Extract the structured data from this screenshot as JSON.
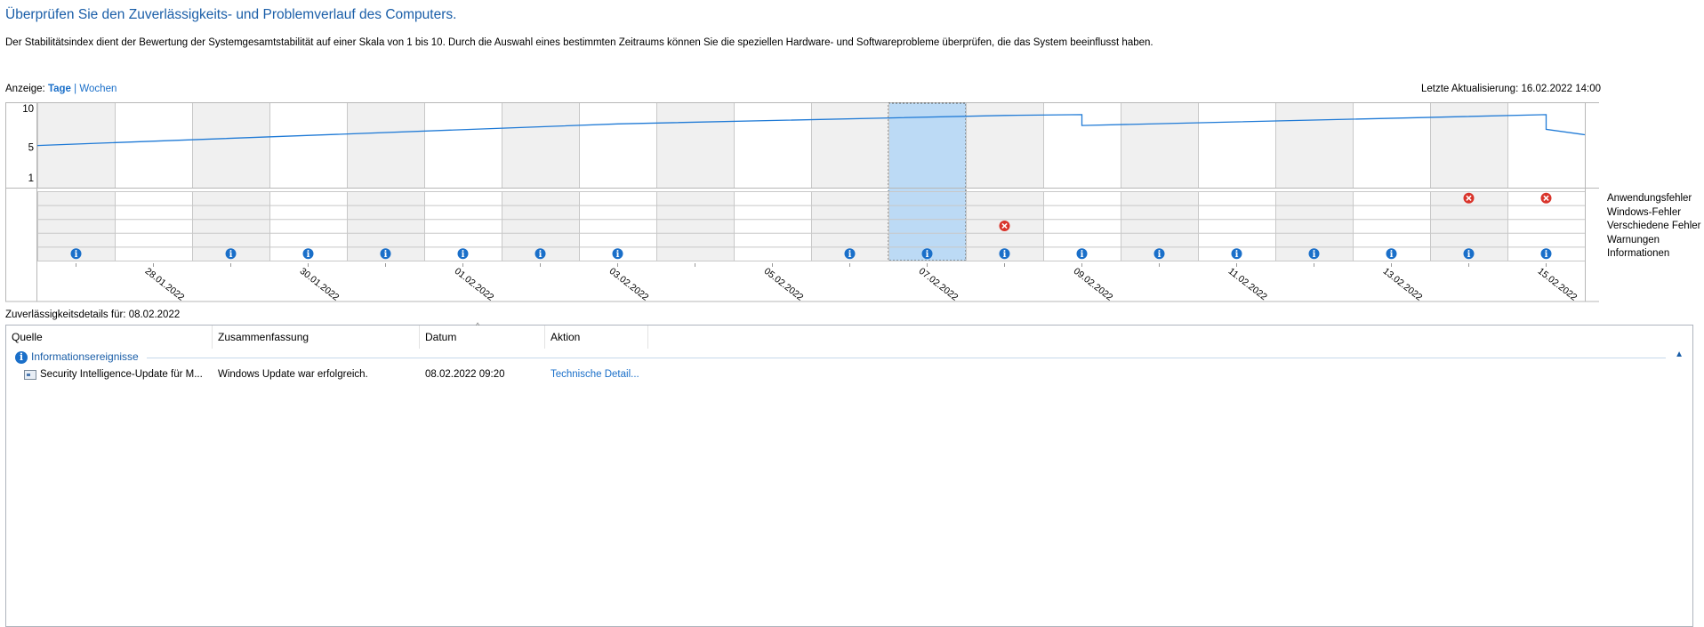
{
  "header": {
    "title": "Überprüfen Sie den Zuverlässigkeits- und Problemverlauf des Computers.",
    "description": "Der Stabilitätsindex dient der Bewertung der Systemgesamtstabilität auf einer Skala von 1 bis 10. Durch die Auswahl eines bestimmten Zeitraums können Sie die speziellen Hardware- und Softwareprobleme überprüfen, die das System beeinflusst haben."
  },
  "view": {
    "label": "Anzeige:",
    "days": "Tage",
    "separator": "|",
    "weeks": "Wochen"
  },
  "last_update": "Letzte Aktualisierung: 16.02.2022 14:00",
  "chart": {
    "y_ticks": [
      "10",
      "5",
      "1"
    ],
    "row_labels": [
      "Anwendungsfehler",
      "Windows-Fehler",
      "Verschiedene Fehler",
      "Warnungen",
      "Informationen"
    ],
    "x_tick_labels": [
      "28.01.2022",
      "30.01.2022",
      "01.02.2022",
      "03.02.2022",
      "05.02.2022",
      "07.02.2022",
      "09.02.2022",
      "11.02.2022",
      "13.02.2022",
      "15.02.2022"
    ],
    "selected_day_index": 11,
    "colors": {
      "line": "#1f7ad6",
      "selected_fill": "#bcdaf5",
      "error": "#d9342b",
      "info": "#1a6fc9",
      "shaded": "#f0f0f0"
    }
  },
  "chart_data": {
    "type": "line",
    "title": "",
    "ylim": [
      1,
      10
    ],
    "y_ticks": [
      10,
      5,
      1
    ],
    "x_range": [
      "27.01.2022",
      "16.02.2022"
    ],
    "days": 20,
    "series": [
      {
        "values": [
          {
            "x": "27.01.2022",
            "y": 5.2
          },
          {
            "x": "03.02.2022",
            "y": 8.0
          },
          {
            "x": "08.02.2022",
            "y": 9.1
          },
          {
            "x": "09.02.2022",
            "y": 9.2
          },
          {
            "x": "09.02.2022",
            "y": 7.8
          },
          {
            "x": "15.02.2022",
            "y": 9.2
          },
          {
            "x": "15.02.2022",
            "y": 7.3
          },
          {
            "x": "16.02.2022",
            "y": 6.6
          }
        ]
      }
    ],
    "events": {
      "Anwendungsfehler": [
        18,
        19
      ],
      "Verschiedene Fehler": [
        12
      ],
      "Informationen": [
        0,
        2,
        3,
        4,
        5,
        6,
        7,
        10,
        11,
        12,
        13,
        14,
        15,
        16,
        17,
        18,
        19
      ]
    }
  },
  "details": {
    "label": "Zuverlässigkeitsdetails für: 08.02.2022",
    "columns": [
      "Quelle",
      "Zusammenfassung",
      "Datum",
      "Aktion"
    ],
    "groups": [
      {
        "label": "Informationsereignisse",
        "rows": [
          {
            "source": "Security Intelligence-Update für M...",
            "summary": "Windows Update war erfolgreich.",
            "date": "08.02.2022 09:20",
            "action": "Technische Detail..."
          }
        ]
      }
    ]
  }
}
